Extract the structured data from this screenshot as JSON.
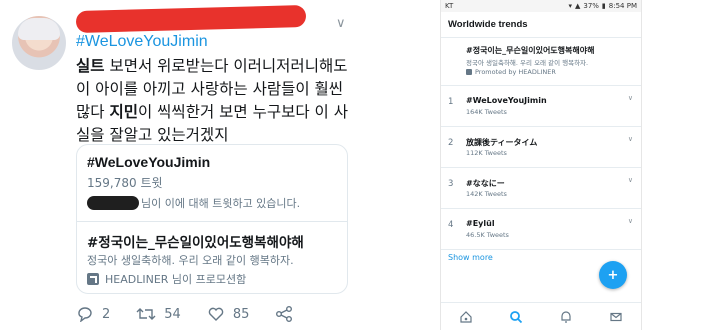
{
  "tweet": {
    "hashtag": "#WeLoveYouJimin",
    "body_parts": [
      {
        "text": "실트",
        "bold": true
      },
      {
        "text": " 보면서 위로받는다 이러니저러니해도 이 아이를 아끼고 사랑하는 사람들이 훨씬 많다 ",
        "bold": false
      },
      {
        "text": "지민",
        "bold": true
      },
      {
        "text": "이 씩씩한거 보면 누구보다 이 사실을 잘알고 있는거겠지",
        "bold": false
      }
    ],
    "card": {
      "tag1": "#WeLoveYouJimin",
      "count": "159,780 트윗",
      "who_suffix": "님이 이에 대해 트윗하고 있습니다.",
      "tag2": "#정국이는_무슨일이있어도행복해야해",
      "desc": "정국아 생일축하해. 우리 오래 같이 행복하자.",
      "promo": "HEADLINER 님이 프로모션함"
    },
    "actions": {
      "reply": "2",
      "retweet": "54",
      "like": "85"
    }
  },
  "phone": {
    "status": {
      "carrier": "KT",
      "battery": "37%",
      "time": "8:54 PM"
    },
    "title": "Worldwide trends",
    "promoted": {
      "name": "#정국이는_무슨일이있어도행복해야해",
      "desc": "정국아 생일축하해. 우리 오래 같이 행복하자.",
      "promo": "Promoted by HEADLINER"
    },
    "trends": [
      {
        "rank": "1",
        "name": "#WeLoveYouJimin",
        "count": "164K Tweets"
      },
      {
        "rank": "2",
        "name": "放課後ティータイム",
        "count": "112K Tweets"
      },
      {
        "rank": "3",
        "name": "#ななにー",
        "count": "142K Tweets"
      },
      {
        "rank": "4",
        "name": "#Eylül",
        "count": "46.5K Tweets"
      }
    ],
    "show_more": "Show more"
  }
}
